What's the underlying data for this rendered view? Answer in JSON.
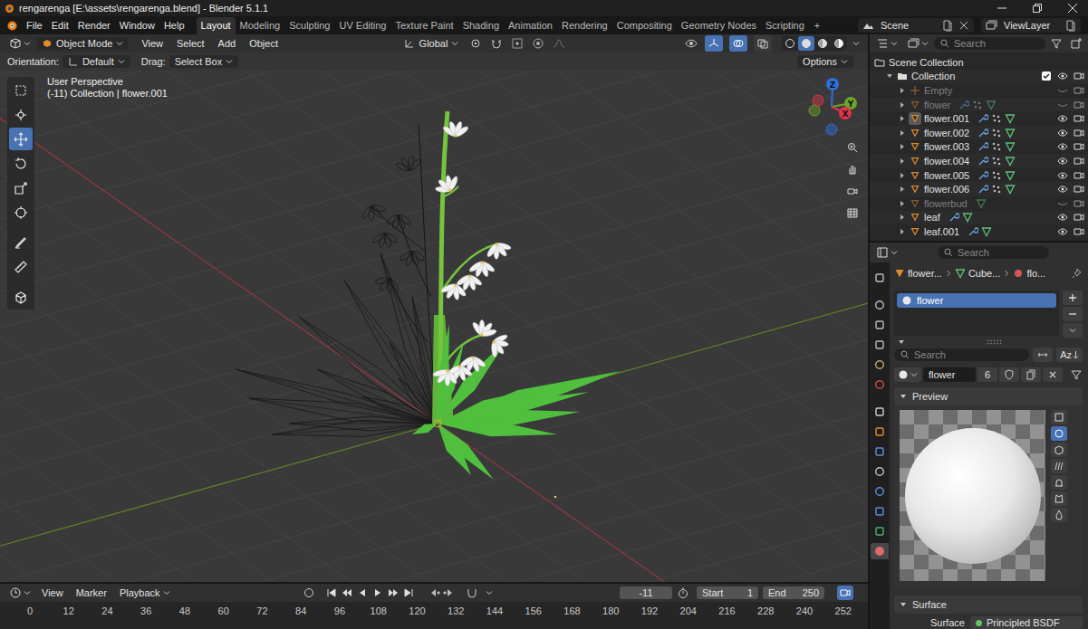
{
  "window": {
    "title": "rengarenga [E:\\assets\\rengarenga.blend] - Blender 5.1.1"
  },
  "menu": [
    "File",
    "Edit",
    "Render",
    "Window",
    "Help"
  ],
  "workspaces": [
    {
      "label": "Layout",
      "selected": true
    },
    {
      "label": "Modeling",
      "selected": false
    },
    {
      "label": "Sculpting",
      "selected": false
    },
    {
      "label": "UV Editing",
      "selected": false
    },
    {
      "label": "Texture Paint",
      "selected": false
    },
    {
      "label": "Shading",
      "selected": false
    },
    {
      "label": "Animation",
      "selected": false
    },
    {
      "label": "Rendering",
      "selected": false
    },
    {
      "label": "Compositing",
      "selected": false
    },
    {
      "label": "Geometry Nodes",
      "selected": false
    },
    {
      "label": "Scripting",
      "selected": false
    }
  ],
  "add_workspace": "+",
  "scene": "Scene",
  "view_layer": "ViewLayer",
  "viewport": {
    "mode": "Object Mode",
    "menus": [
      "View",
      "Select",
      "Add",
      "Object"
    ],
    "transform_orientation": "Global",
    "gizmos": true,
    "overlays": true,
    "xray": false,
    "shading": [
      {
        "selected": false
      },
      {
        "selected": true
      },
      {
        "selected": false
      },
      {
        "selected": false
      }
    ],
    "tool_settings": {
      "orientation_label": "Orientation:",
      "orientation": "Default",
      "drag_label": "Drag:",
      "drag": "Select Box",
      "options": "Options"
    },
    "info": [
      "User Perspective",
      "(-11) Collection | flower.001"
    ],
    "tools": [
      {
        "selected": false
      },
      {
        "selected": false
      },
      {
        "selected": true
      },
      {
        "selected": false
      },
      {
        "selected": false
      },
      {
        "selected": false
      },
      {
        "selected": false
      },
      {
        "selected": false
      },
      {
        "selected": false
      }
    ],
    "gizmo_axes": [
      {
        "label": "Z",
        "color": "#2f6fdb"
      },
      {
        "label": "Y",
        "color": "#6ba52a"
      },
      {
        "label": "X",
        "color": "#e0344a"
      }
    ]
  },
  "outliner": {
    "search_placeholder": "Search",
    "items": [
      {
        "name": "Scene Collection",
        "kind": "scene",
        "depth": 0,
        "hidden": false,
        "selected": false,
        "modifiers": false,
        "particles": false
      },
      {
        "name": "Collection",
        "kind": "collection",
        "depth": 1,
        "hidden": false,
        "selected": false,
        "modifiers": false,
        "particles": false,
        "expanded": true,
        "checked": true
      },
      {
        "name": "Empty",
        "kind": "empty",
        "depth": 2,
        "hidden": true,
        "selected": false,
        "modifiers": false,
        "particles": false,
        "expanded": false
      },
      {
        "name": "flower",
        "kind": "mesh",
        "depth": 2,
        "hidden": true,
        "selected": false,
        "modifiers": true,
        "particles": true,
        "expanded": false
      },
      {
        "name": "flower.001",
        "kind": "mesh",
        "depth": 2,
        "hidden": false,
        "selected": true,
        "modifiers": true,
        "particles": true,
        "expanded": false
      },
      {
        "name": "flower.002",
        "kind": "mesh",
        "depth": 2,
        "hidden": false,
        "selected": false,
        "modifiers": true,
        "particles": true,
        "expanded": false
      },
      {
        "name": "flower.003",
        "kind": "mesh",
        "depth": 2,
        "hidden": false,
        "selected": false,
        "modifiers": true,
        "particles": true,
        "expanded": false
      },
      {
        "name": "flower.004",
        "kind": "mesh",
        "depth": 2,
        "hidden": false,
        "selected": false,
        "modifiers": true,
        "particles": true,
        "expanded": false
      },
      {
        "name": "flower.005",
        "kind": "mesh",
        "depth": 2,
        "hidden": false,
        "selected": false,
        "modifiers": true,
        "particles": true,
        "expanded": false
      },
      {
        "name": "flower.006",
        "kind": "mesh",
        "depth": 2,
        "hidden": false,
        "selected": false,
        "modifiers": true,
        "particles": true,
        "expanded": false
      },
      {
        "name": "flowerbud",
        "kind": "mesh",
        "depth": 2,
        "hidden": true,
        "selected": false,
        "modifiers": false,
        "particles": false,
        "expanded": false
      },
      {
        "name": "leaf",
        "kind": "mesh",
        "depth": 2,
        "hidden": false,
        "selected": false,
        "modifiers": true,
        "particles": false,
        "expanded": false
      },
      {
        "name": "leaf.001",
        "kind": "mesh",
        "depth": 2,
        "hidden": false,
        "selected": false,
        "modifiers": true,
        "particles": false,
        "expanded": false
      }
    ]
  },
  "properties": {
    "search_placeholder": "Search",
    "tabs": [
      {
        "selected": false
      },
      {
        "selected": false
      },
      {
        "selected": false
      },
      {
        "selected": false
      },
      {
        "selected": false
      },
      {
        "selected": false
      },
      {
        "selected": false
      },
      {
        "selected": false
      },
      {
        "selected": false
      },
      {
        "selected": false
      },
      {
        "selected": false
      },
      {
        "selected": false
      },
      {
        "selected": false
      },
      {
        "selected": true
      }
    ],
    "breadcrumb": [
      "flower...",
      "Cube...",
      "flo..."
    ],
    "material_slots": [
      {
        "name": "flower",
        "selected": true
      }
    ],
    "slot_filter_placeholder": "Search",
    "sort_label": "Az",
    "material": {
      "name": "flower",
      "users": "6"
    },
    "preview": {
      "label": "Preview",
      "expanded": true,
      "types": [
        {
          "selected": false
        },
        {
          "selected": true
        },
        {
          "selected": false
        },
        {
          "selected": false
        },
        {
          "selected": false
        },
        {
          "selected": false
        },
        {
          "selected": false
        }
      ]
    },
    "surface": {
      "label": "Surface",
      "expanded": true,
      "field_label": "Surface",
      "shader": "Principled BSDF"
    }
  },
  "timeline": {
    "menus": [
      "View",
      "Marker",
      "Playback"
    ],
    "current_frame": "-11",
    "start_label": "Start",
    "start": "1",
    "end_label": "End",
    "end": "250",
    "ruler": [
      "0",
      "12",
      "24",
      "36",
      "48",
      "60",
      "72",
      "84",
      "96",
      "108",
      "120",
      "132",
      "144",
      "156",
      "168",
      "180",
      "192",
      "204",
      "216",
      "228",
      "240",
      "252"
    ]
  }
}
